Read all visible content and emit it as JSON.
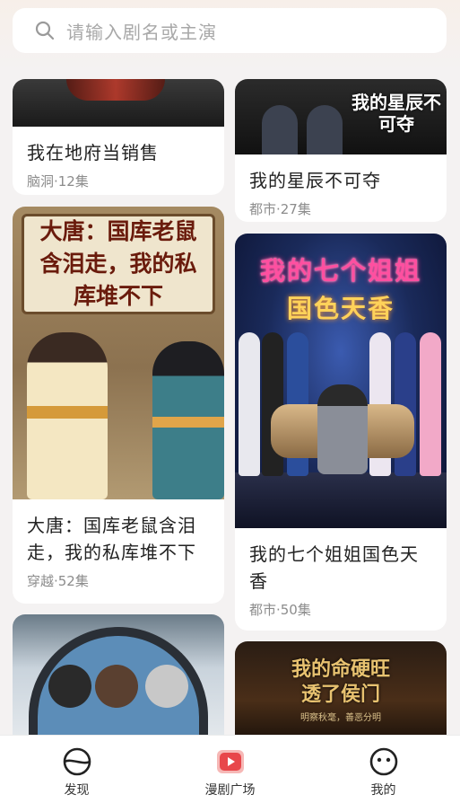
{
  "search": {
    "placeholder": "请输入剧名或主演"
  },
  "feed": {
    "left": [
      {
        "title": "我在地府当销售",
        "meta": "脑洞·12集"
      },
      {
        "title": "大唐：国库老鼠含泪走，我的私库堆不下",
        "meta": "穿越·52集",
        "cover_text": "大唐：国库老鼠含泪走，我的私库堆不下"
      },
      {
        "title": "",
        "meta": ""
      }
    ],
    "right": [
      {
        "title": "我的星辰不可夺",
        "meta": "都市·27集",
        "cover_text": "我的星辰不可夺"
      },
      {
        "title": "我的七个姐姐国色天香",
        "meta": "都市·50集",
        "cover_text_line1": "我的七个姐姐",
        "cover_text_line2": "国色天香"
      },
      {
        "title": "",
        "meta": "",
        "cover_text": "我的命硬旺透了侯门",
        "cover_sub": "明察秋毫，善恶分明"
      }
    ]
  },
  "nav": {
    "items": [
      {
        "label": "发现",
        "icon": "discover-icon"
      },
      {
        "label": "漫剧广场",
        "icon": "play-square-icon"
      },
      {
        "label": "我的",
        "icon": "profile-face-icon"
      }
    ],
    "active_color": "#e8474b"
  }
}
